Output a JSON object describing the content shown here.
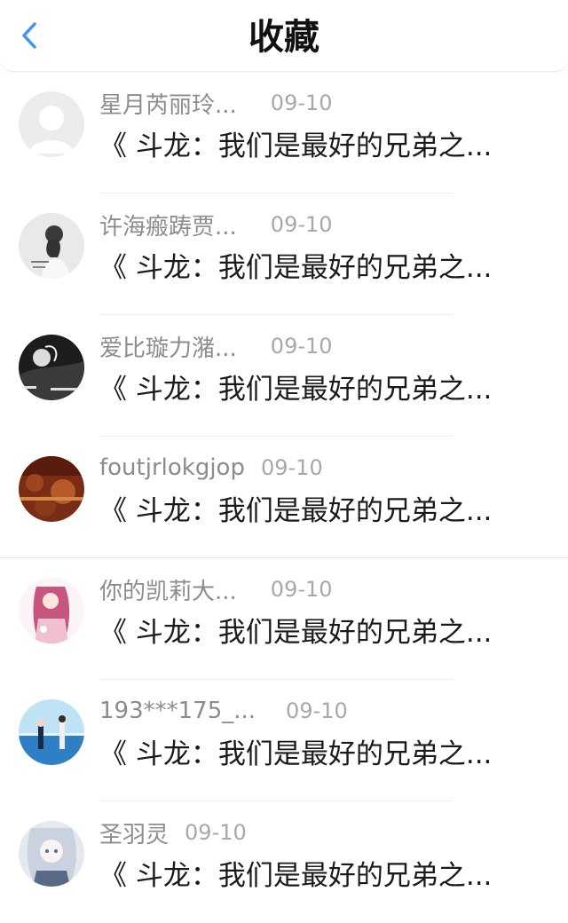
{
  "header": {
    "title": "收藏",
    "back_icon": "chevron-left-icon",
    "accent_color": "#3c96f0"
  },
  "items": [
    {
      "username": "星月芮丽玲...",
      "date": "09-10",
      "title": "《 斗龙：我们是最好的兄弟之...",
      "avatar": "default-avatar-icon"
    },
    {
      "username": "许海瘢踌贾...",
      "date": "09-10",
      "title": "《 斗龙：我们是最好的兄弟之...",
      "avatar": "girl-photo"
    },
    {
      "username": "爱比璇力潴...",
      "date": "09-10",
      "title": "《 斗龙：我们是最好的兄弟之...",
      "avatar": "dark-photo"
    },
    {
      "username": "foutjrlokgjop",
      "date": "09-10",
      "title": "《 斗龙：我们是最好的兄弟之...",
      "avatar": "autumn-photo"
    },
    {
      "username": "你的凯莉大...",
      "date": "09-10",
      "title": "《 斗龙：我们是最好的兄弟之...",
      "avatar": "anime-pink-photo"
    },
    {
      "username": "193***175_...",
      "date": "09-10",
      "title": "《 斗龙：我们是最好的兄弟之...",
      "avatar": "sea-anime-photo"
    },
    {
      "username": "圣羽灵",
      "date": "09-10",
      "title": "《 斗龙：我们是最好的兄弟之...",
      "avatar": "anime-silver-photo"
    }
  ]
}
